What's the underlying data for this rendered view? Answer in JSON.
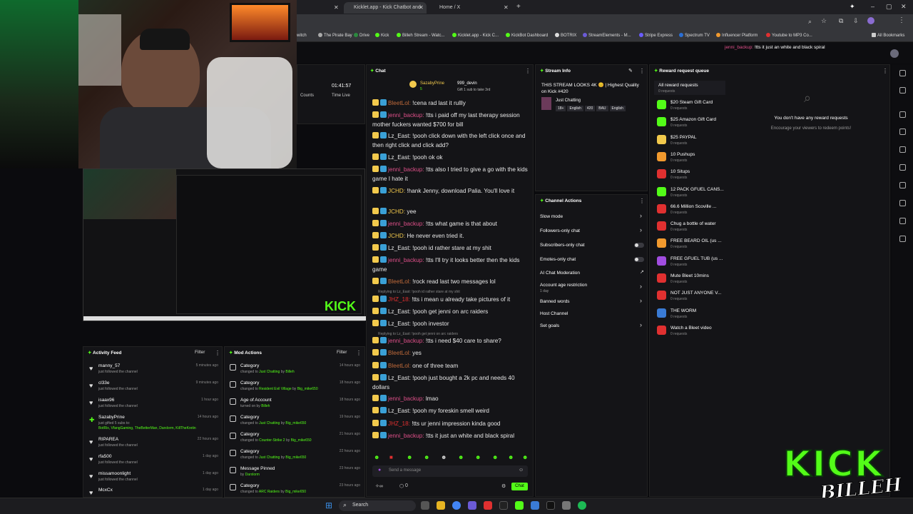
{
  "tabs": [
    {
      "label": "Kicklet.app - Kick Chatbot and"
    },
    {
      "label": "Home / X"
    }
  ],
  "bookmarks": [
    "witch",
    "The Pirate Bay",
    "Drive",
    "Kick",
    "Billeh Stream - Watc...",
    "Kicklet.app - Kick C...",
    "KickBot Dashboard",
    "BOTRIX",
    "StreamElements - M...",
    "Stripe Express",
    "Spectrum TV",
    "Influencer Platform",
    "Youtube to MP3 Co...",
    "All Bookmarks"
  ],
  "header_alert": {
    "user": "jenni_backup:",
    "text": "!tts it just an white and black spiral"
  },
  "stats": {
    "time": "01:41:57",
    "time_label": "Time Live",
    "counts_label": "Counts"
  },
  "chat": {
    "title": "Chat",
    "pinned_user": "SazabyPrine",
    "pinned_count": "5",
    "gifter": "999_devin",
    "gift_text": "Gift 1 sub to take 3rd",
    "messages": [
      {
        "user": "BleetLol:",
        "text": "!cena rad last it rullly",
        "color": "#c06a3a"
      },
      {
        "user": "jenni_backup:",
        "text": "!tts i paid off my last therapy session mother fuckers wanted $700 for bill",
        "color": "#e0508a"
      },
      {
        "user": "Lz_East:",
        "text": "!pooh click down with the left click once and then right click and click add?",
        "color": "#e6e6e6"
      },
      {
        "user": "Lz_East:",
        "text": "!pooh ok ok",
        "color": "#e6e6e6"
      },
      {
        "user": "jenni_backup:",
        "text": "!tts also I tried to give a go with the kids game I hate it",
        "color": "#e0508a"
      },
      {
        "user": "JCHD:",
        "text": "!hank Jenny, download Palia. You'll love it",
        "color": "#f2c94c"
      },
      {
        "user": "JCHD:",
        "text": "yee",
        "color": "#f2c94c"
      },
      {
        "user": "jenni_backup:",
        "text": "!tts what game is that about",
        "color": "#e0508a"
      },
      {
        "user": "JCHD:",
        "text": "He never even tried it.",
        "color": "#f2c94c"
      },
      {
        "user": "Lz_East:",
        "text": "!pooh id rather stare at my shit",
        "color": "#e6e6e6"
      },
      {
        "user": "jenni_backup:",
        "text": "!tts I'll try it looks better then the kids game",
        "color": "#e0508a"
      },
      {
        "user": "BleetLol:",
        "text": "!rock read last two messages lol",
        "color": "#c06a3a"
      },
      {
        "user": "JHZ_18:",
        "text": "!tts i mean u already take pictures of it",
        "color": "#e03030"
      },
      {
        "user": "Lz_East:",
        "text": "!pooh get jenni on arc raiders",
        "color": "#e6e6e6"
      },
      {
        "user": "Lz_East:",
        "text": "!pooh investor",
        "color": "#e6e6e6"
      },
      {
        "user": "jenni_backup:",
        "text": "!tts i need $40 care to share?",
        "color": "#e0508a"
      },
      {
        "user": "BleetLol:",
        "text": "yes",
        "color": "#c06a3a"
      },
      {
        "user": "BleetLol:",
        "text": "one of three team",
        "color": "#c06a3a"
      },
      {
        "user": "Lz_East:",
        "text": "!pooh just bought a 2k pc and needs 40 dollars",
        "color": "#e6e6e6"
      },
      {
        "user": "jenni_backup:",
        "text": "lmao",
        "color": "#e0508a"
      },
      {
        "user": "Lz_East:",
        "text": "!pooh my foreskin smell weird",
        "color": "#e6e6e6"
      },
      {
        "user": "JHZ_18:",
        "text": "!tts ur jenni impression kinda good",
        "color": "#e03030"
      },
      {
        "user": "jenni_backup:",
        "text": "!tts it just an white and black spiral",
        "color": "#e0508a"
      }
    ],
    "reply_1": "Replying to Lz_East: !pooh id rather stare at my shit",
    "reply_2": "Replying to Lz_East: !pooh get jenni on arc raiders",
    "input_placeholder": "Send a message",
    "count": "0",
    "send_label": "Chat"
  },
  "stream_info": {
    "title": "Stream Info",
    "stream_title": "THIS STREAM LOOKS 4K 😊 | Highest Quality on Kick #420",
    "category": "Just Chatting",
    "tags": [
      "18+",
      "English",
      "420",
      "BAU",
      "English"
    ]
  },
  "channel_actions": {
    "title": "Channel Actions",
    "items": [
      "Slow mode",
      "Followers-only chat",
      "Subscribers-only chat",
      "Emotes-only chat",
      "AI Chat Moderation",
      "Account age restriction",
      "Banned words",
      "Host Channel",
      "Set goals"
    ],
    "age_sub": "1 day"
  },
  "reward": {
    "title": "Reward request queue",
    "all": "All reward requests",
    "all_sub": "0 requests",
    "empty_title": "You don't have any reward requests",
    "empty_sub": "Encourage your viewers to redeem points!",
    "items": [
      {
        "name": "$20 Steam Gift Card",
        "sub": "0 requests",
        "color": "#53fc18"
      },
      {
        "name": "$25 Amazon Gift Card",
        "sub": "0 requests",
        "color": "#53fc18"
      },
      {
        "name": "$25 PAYPAL",
        "sub": "0 requests",
        "color": "#f2c94c"
      },
      {
        "name": "10 Pushups",
        "sub": "0 requests",
        "color": "#f29a2e"
      },
      {
        "name": "10 Situps",
        "sub": "0 requests",
        "color": "#e03030"
      },
      {
        "name": "12 PACK GFUEL CANS...",
        "sub": "0 requests",
        "color": "#53fc18"
      },
      {
        "name": "66.6 Million Scoville ...",
        "sub": "0 requests",
        "color": "#e03030"
      },
      {
        "name": "Chug a bottle of water",
        "sub": "0 requests",
        "color": "#e03030"
      },
      {
        "name": "FREE BEARD OIL (us ...",
        "sub": "0 requests",
        "color": "#f29a2e"
      },
      {
        "name": "FREE GFUEL TUB (us ...",
        "sub": "0 requests",
        "color": "#a14de0"
      },
      {
        "name": "Mute Bleet 10mins",
        "sub": "0 requests",
        "color": "#e03030"
      },
      {
        "name": "NOT JUST ANYONE V...",
        "sub": "0 requests",
        "color": "#e03030"
      },
      {
        "name": "THE WORM",
        "sub": "0 requests",
        "color": "#3a7bd5"
      },
      {
        "name": "Watch a Bleet video",
        "sub": "0 requests",
        "color": "#e03030"
      }
    ]
  },
  "activity": {
    "title": "Activity Feed",
    "filter": "Filter",
    "items": [
      {
        "name": "manny_57",
        "sub": "just followed the channel",
        "time": "5 minutes ago"
      },
      {
        "name": "cl33e",
        "sub": "just followed the channel",
        "time": "9 minutes ago"
      },
      {
        "name": "isaax96",
        "sub": "just followed the channel",
        "time": "1 hour ago"
      },
      {
        "name": "SazabyPrine",
        "sub": "just gifted 5 subs to:",
        "time": "14 hours ago",
        "extra": "BotRix, VfangGaming, TheBetterMan, Darxlorm, KillTheKretin"
      },
      {
        "name": "RIPAREA",
        "sub": "just followed the channel",
        "time": "22 hours ago"
      },
      {
        "name": "rfa500",
        "sub": "just followed the channel",
        "time": "1 day ago"
      },
      {
        "name": "missamoonlight",
        "sub": "just followed the channel",
        "time": "1 day ago"
      },
      {
        "name": "McxCx",
        "sub": "",
        "time": "1 day ago"
      }
    ]
  },
  "mod_actions": {
    "title": "Mod Actions",
    "filter": "Filter",
    "items": [
      {
        "name": "Category",
        "pre": "changed to",
        "hl": "Just Chatting",
        "post": "by",
        "by": "Billeh",
        "time": "14 hours ago"
      },
      {
        "name": "Category",
        "pre": "changed to",
        "hl": "Resident Evil Village",
        "post": "by",
        "by": "Big_mike650",
        "time": "18 hours ago"
      },
      {
        "name": "Age of Account",
        "pre": "turned on by",
        "hl": "",
        "post": "",
        "by": "Billeh",
        "time": "18 hours ago"
      },
      {
        "name": "Category",
        "pre": "changed to",
        "hl": "Just Chatting",
        "post": "by",
        "by": "Big_mike650",
        "time": "19 hours ago"
      },
      {
        "name": "Category",
        "pre": "changed to",
        "hl": "Counter-Strike 2",
        "post": "by",
        "by": "Big_mike650",
        "time": "21 hours ago"
      },
      {
        "name": "Category",
        "pre": "changed to",
        "hl": "Just Chatting",
        "post": "by",
        "by": "Big_mike650",
        "time": "22 hours ago"
      },
      {
        "name": "Message Pinned",
        "pre": "by",
        "hl": "",
        "post": "",
        "by": "Darxlorm",
        "time": "23 hours ago"
      },
      {
        "name": "Category",
        "pre": "changed to",
        "hl": "ARC Raiders",
        "post": "by",
        "by": "Big_mike650",
        "time": "23 hours ago"
      }
    ]
  },
  "overlay": {
    "logo_top": "KICK",
    "logo_bottom": "BILLEH"
  },
  "taskbar": {
    "search": "Search"
  },
  "colors": {
    "accent": "#53fc18",
    "panel": "#141417",
    "bg": "#0b0b0e"
  }
}
